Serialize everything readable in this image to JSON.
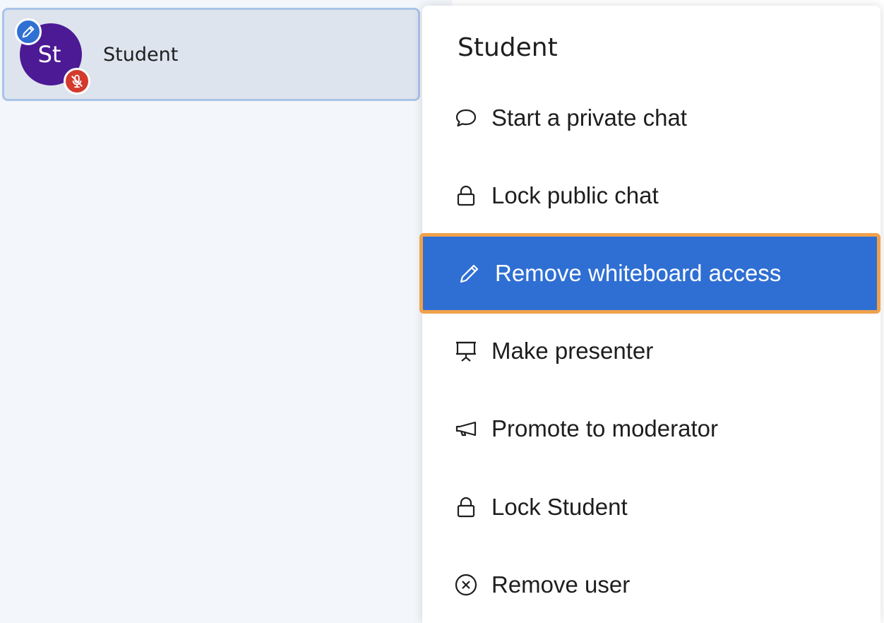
{
  "user": {
    "name": "Student",
    "initials": "St",
    "avatar_color": "#4c1a94",
    "badges": [
      {
        "icon": "pencil-icon",
        "color": "#2f70d3"
      },
      {
        "icon": "mic-muted-icon",
        "color": "#d33a2c"
      }
    ]
  },
  "menu": {
    "title": "Student",
    "items": [
      {
        "label": "Start a private chat",
        "icon": "chat-bubble-icon"
      },
      {
        "label": "Lock public chat",
        "icon": "lock-icon"
      },
      {
        "label": "Remove whiteboard access",
        "icon": "pencil-icon",
        "active": true
      },
      {
        "label": "Make presenter",
        "icon": "presentation-screen-icon"
      },
      {
        "label": "Promote to moderator",
        "icon": "megaphone-icon"
      },
      {
        "label": "Lock Student",
        "icon": "lock-icon"
      },
      {
        "label": "Remove user",
        "icon": "close-circle-icon"
      }
    ],
    "colors": {
      "active_bg": "#2f6fd3",
      "active_outline": "#f0a14a"
    }
  }
}
